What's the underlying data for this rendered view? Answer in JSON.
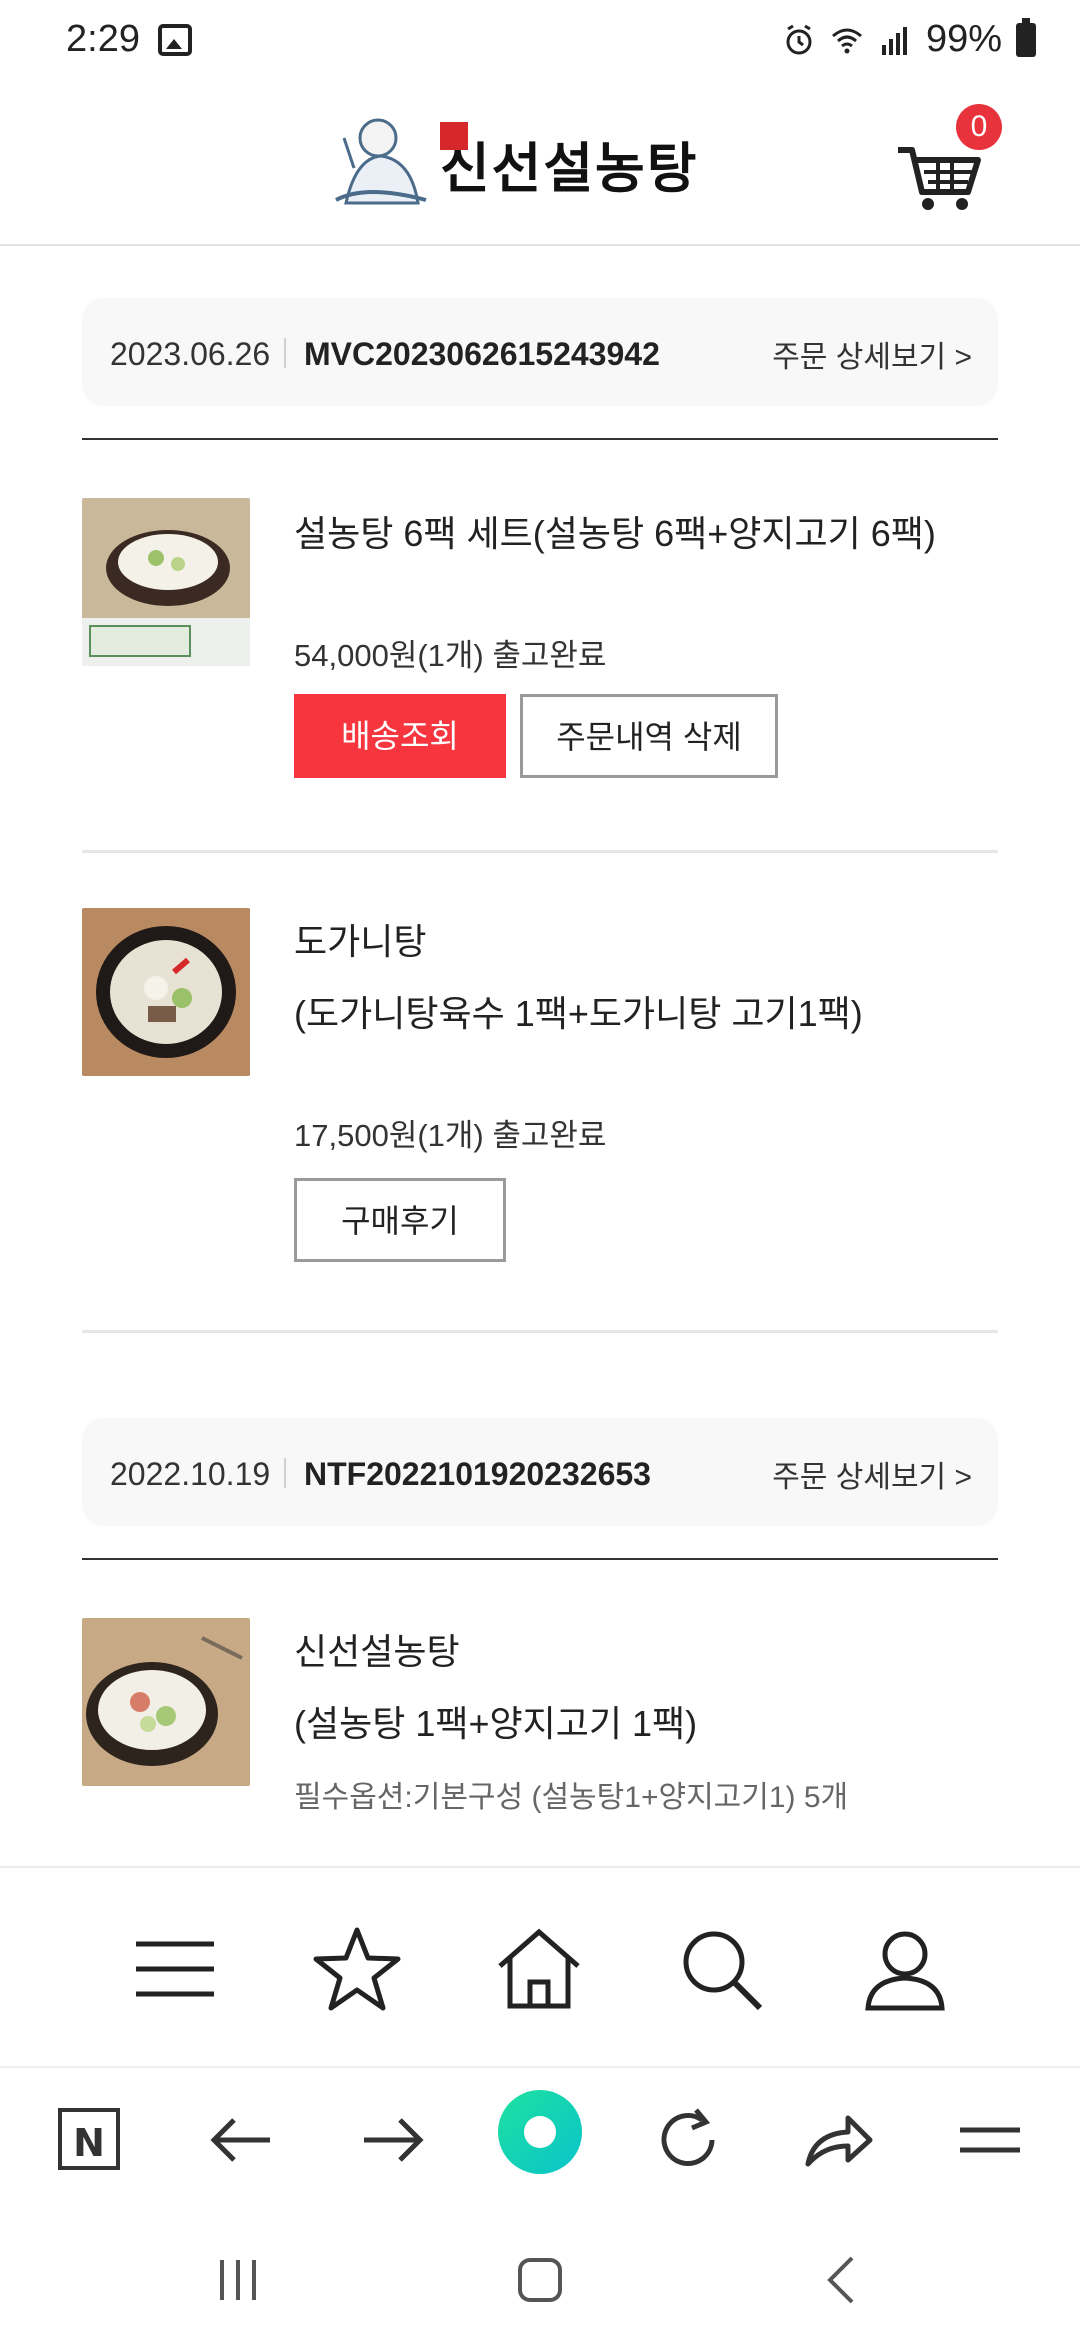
{
  "status_bar": {
    "time": "2:29",
    "battery": "99%"
  },
  "header": {
    "logo_text": "신선설농탕",
    "cart_count": "0"
  },
  "orders": [
    {
      "date": "2023.06.26",
      "order_no": "MVC2023062615243942",
      "detail_link": "주문 상세보기 >",
      "items": [
        {
          "title": "설농탕 6팩 세트(설농탕 6팩+양지고기 6팩)",
          "price_status": "54,000원(1개) 출고완료",
          "buttons": [
            "배송조회",
            "주문내역 삭제"
          ]
        },
        {
          "title_line1": "도가니탕",
          "title_line2": "(도가니탕육수 1팩+도가니탕 고기1팩)",
          "price_status": "17,500원(1개) 출고완료",
          "buttons": [
            "구매후기"
          ]
        }
      ]
    },
    {
      "date": "2022.10.19",
      "order_no": "NTF2022101920232653",
      "detail_link": "주문 상세보기 >",
      "items": [
        {
          "title_line1": "신선설농탕",
          "title_line2": "(설농탕 1팩+양지고기 1팩)",
          "option": "필수옵션:기본구성 (설농탕1+양지고기1) 5개"
        }
      ]
    }
  ],
  "bottom_nav": [
    "menu-icon",
    "star-icon",
    "home-icon",
    "search-icon",
    "user-icon"
  ],
  "browser_bar": [
    "naver-icon",
    "back-arrow-icon",
    "forward-arrow-icon",
    "green-dot-icon",
    "refresh-icon",
    "share-icon",
    "menu-icon"
  ],
  "colors": {
    "accent_red": "#f6353f",
    "badge_red": "#e8323c",
    "green_a": "#1fe0a0",
    "green_b": "#09c4c9"
  }
}
